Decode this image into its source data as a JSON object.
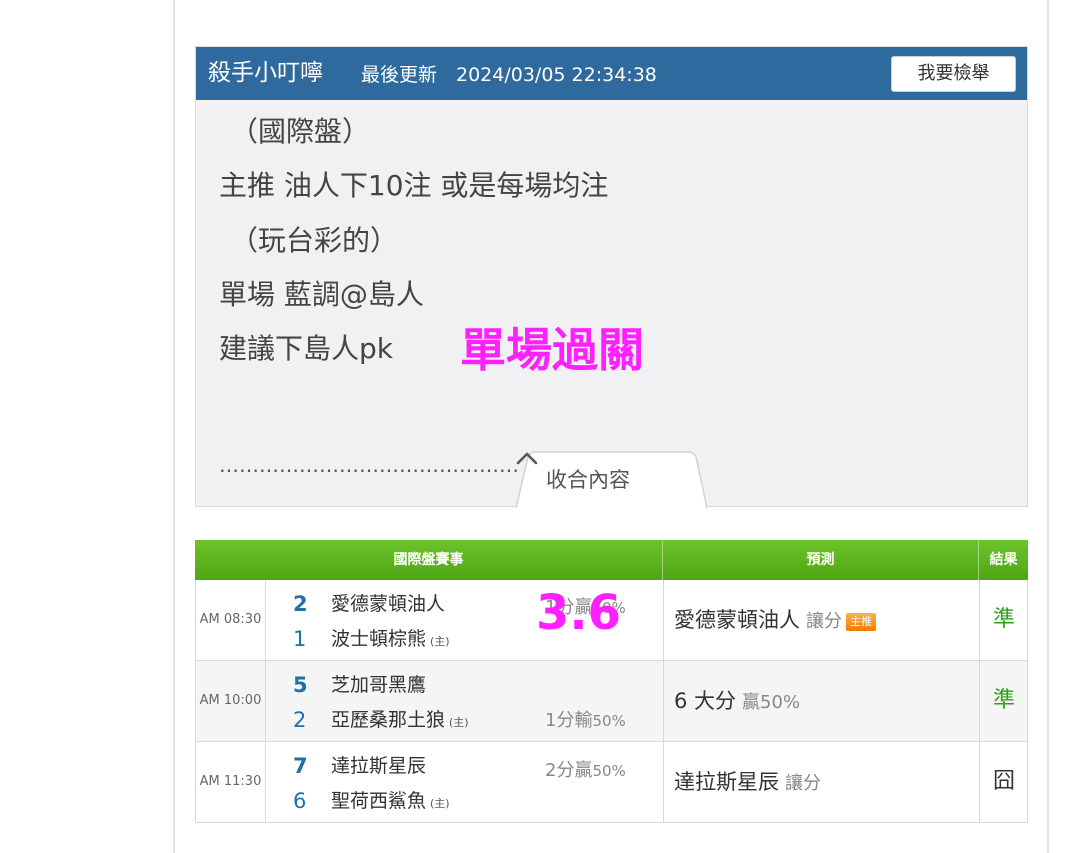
{
  "post": {
    "author": "殺手小叮嚀",
    "update_label": "最後更新",
    "update_time": "2024/03/05 22:34:38",
    "report_button": "我要檢舉",
    "lines": [
      "（國際盤）",
      "主推 油人下10注 或是每場均注",
      "（玩台彩的）",
      "單場 藍調@島人",
      "建議下島人pk"
    ],
    "overlay_text": "單場過關",
    "dots": "………………………………………",
    "collapse_label": "收合內容"
  },
  "table": {
    "headers": {
      "match": "國際盤賽事",
      "prediction": "預測",
      "result": "結果"
    },
    "overlay_number": "3.6",
    "rows": [
      {
        "time": "AM 08:30",
        "away_score": "2",
        "away_team": "愛德蒙頓油人",
        "home_score": "1",
        "home_team": "波士頓棕熊",
        "home_mark": "(主)",
        "odds_value": "1分贏",
        "odds_pct": "50%",
        "prediction": "愛德蒙頓油人",
        "prediction_sub": "讓分",
        "badge": "主推",
        "result": "準"
      },
      {
        "time": "AM 10:00",
        "away_score": "5",
        "away_team": "芝加哥黑鷹",
        "home_score": "2",
        "home_team": "亞歷桑那土狼",
        "home_mark": "(主)",
        "odds_value": "1分輸",
        "odds_pct": "50%",
        "prediction": "6 大分",
        "prediction_sub": "贏50%",
        "result": "準"
      },
      {
        "time": "AM 11:30",
        "away_score": "7",
        "away_team": "達拉斯星辰",
        "home_score": "6",
        "home_team": "聖荷西鯊魚",
        "home_mark": "(主)",
        "odds_value": "2分贏",
        "odds_pct": "50%",
        "prediction": "達拉斯星辰",
        "prediction_sub": "讓分",
        "result": "囧"
      }
    ]
  },
  "colors": {
    "header_blue": "#2f6a9e",
    "table_green": "#5cb51f",
    "overlay_magenta": "#ff20ff",
    "hit_green": "#2ea01e",
    "badge_orange": "#f07b00"
  }
}
